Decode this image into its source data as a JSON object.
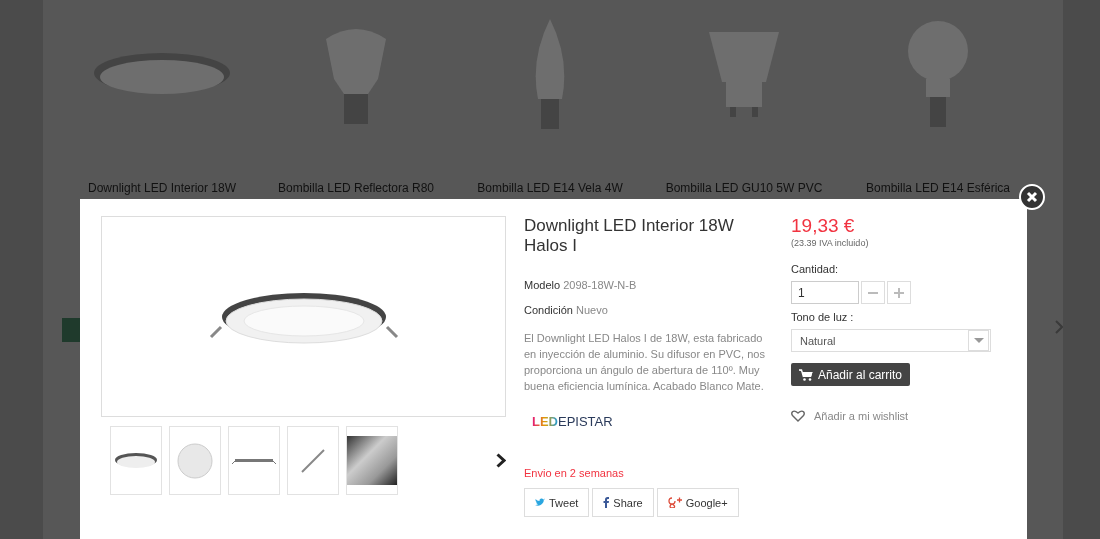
{
  "products": [
    {
      "name": "Downlight LED Interior 18W",
      "kind": "downlight"
    },
    {
      "name": "Bombilla LED Reflectora R80",
      "kind": "reflector"
    },
    {
      "name": "Bombilla LED E14 Vela 4W",
      "kind": "candle"
    },
    {
      "name": "Bombilla LED GU10 5W PVC",
      "kind": "gu10"
    },
    {
      "name": "Bombilla LED E14 Esférica",
      "kind": "globe"
    }
  ],
  "quick_view": {
    "title": "Downlight LED Interior 18W Halos I",
    "thumbnails": [
      {
        "kind": "downlight"
      },
      {
        "kind": "disc"
      },
      {
        "kind": "side"
      },
      {
        "kind": "edge"
      },
      {
        "kind": "photo"
      }
    ],
    "model": {
      "label": "Modelo",
      "value": "2098-18W-N-B"
    },
    "condition": {
      "label": "Condición",
      "value": "Nuevo"
    },
    "description": "El Downlight LED Halos I de 18W, esta fabricado en inyección de aluminio. Su difusor en PVC, nos proporciona un ángulo de abertura de 110º. Muy buena eficiencia lumínica. Acabado Blanco Mate.",
    "brand": {
      "mark": "LED",
      "name": "EPISTAR"
    },
    "availability": "Envio en 2 semanas",
    "share": [
      {
        "label": "Tweet",
        "kind": "twitter"
      },
      {
        "label": "Share",
        "kind": "facebook"
      },
      {
        "label": "Google+",
        "kind": "google"
      }
    ],
    "price": "19,33 €",
    "tax_note": "(23.39 IVA incluido)",
    "quantity": {
      "label": "Cantidad:",
      "value": "1"
    },
    "tone": {
      "label": "Tono de luz :",
      "value": "Natural"
    },
    "add_to_cart": "Añadir al carrito",
    "wishlist": "Añadir a mi wishlist"
  }
}
